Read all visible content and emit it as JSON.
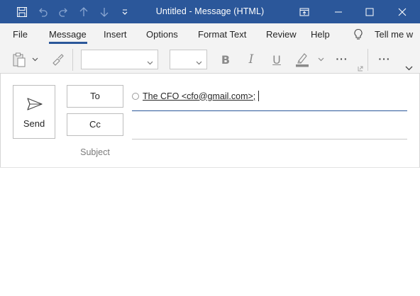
{
  "window": {
    "title": "Untitled  -  Message (HTML)",
    "title_bar_color": "#2b579a",
    "icons": [
      "save-icon",
      "undo-icon",
      "redo-icon",
      "previous-item-icon",
      "next-item-icon",
      "customize-toolbar-icon",
      "restore-window-icon",
      "minimize-icon",
      "maximize-icon",
      "close-icon"
    ]
  },
  "ribbon": {
    "tabs": [
      "File",
      "Message",
      "Insert",
      "Options",
      "Format Text",
      "Review",
      "Help"
    ],
    "active_tab": "Message",
    "tell_me": "Tell me w",
    "toolbar_icons": [
      "paste-icon",
      "format-painter-icon",
      "bold-icon",
      "italic-icon",
      "underline-icon",
      "highlight-icon",
      "more-icon",
      "more-commands-icon",
      "collapse-ribbon-icon"
    ],
    "bold_glyph": "B",
    "italic_glyph": "I",
    "underline_glyph": "U",
    "font_name_value": "",
    "font_size_value": "",
    "more_glyph": "···"
  },
  "compose": {
    "send_label": "Send",
    "to_label": "To",
    "cc_label": "Cc",
    "subject_label": "Subject",
    "to_value": "The CFO <cfo@gmail.com>;",
    "cc_value": "",
    "subject_value": "",
    "body_text": ""
  }
}
